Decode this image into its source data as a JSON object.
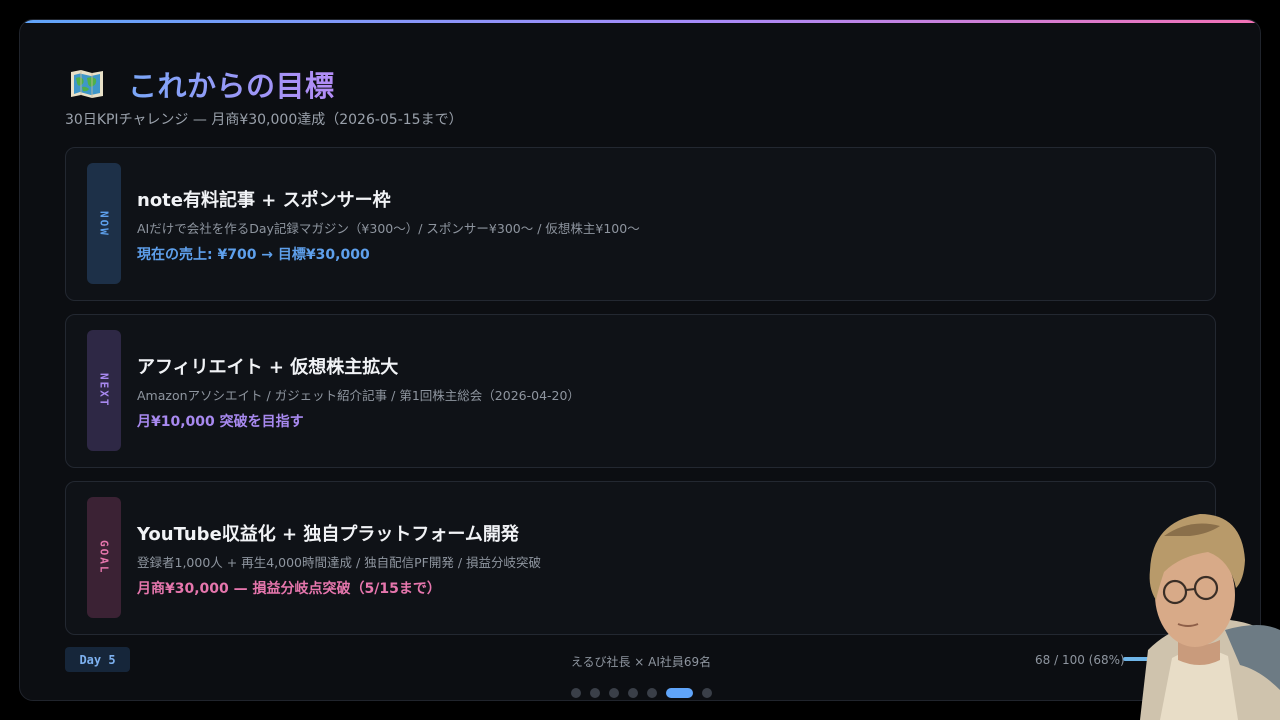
{
  "header": {
    "icon": "map-icon",
    "title": "これからの目標",
    "subtitle": "30日KPIチャレンジ — 月商¥30,000達成（2026-05-15まで）"
  },
  "cards": [
    {
      "tag": "NOW",
      "title": "note有料記事 + スポンサー枠",
      "description": "AIだけで会社を作るDay記録マガジン（¥300〜）/ スポンサー¥300〜 / 仮想株主¥100〜",
      "metric": "現在の売上: ¥700 → 目標¥30,000"
    },
    {
      "tag": "NEXT",
      "title": "アフィリエイト + 仮想株主拡大",
      "description": "Amazonアソシエイト / ガジェット紹介記事 / 第1回株主総会（2026-04-20）",
      "metric": "月¥10,000 突破を目指す"
    },
    {
      "tag": "GOAL",
      "title": "YouTube収益化 + 独自プラットフォーム開発",
      "description": "登録者1,000人 + 再生4,000時間達成 / 独自配信PF開発 / 損益分岐突破",
      "metric": "月商¥30,000 — 損益分岐点突破（5/15まで）"
    }
  ],
  "footer": {
    "day_badge": "Day 5",
    "center_text": "えるび社長 × AI社員69名",
    "progress_text": "68 / 100 (68%)",
    "progress_fraction": 0.68
  },
  "pagination": {
    "count": 7,
    "active_index": 5
  },
  "colors": {
    "now": "#5ea0ec",
    "next": "#a889f0",
    "goal": "#e676ad"
  }
}
